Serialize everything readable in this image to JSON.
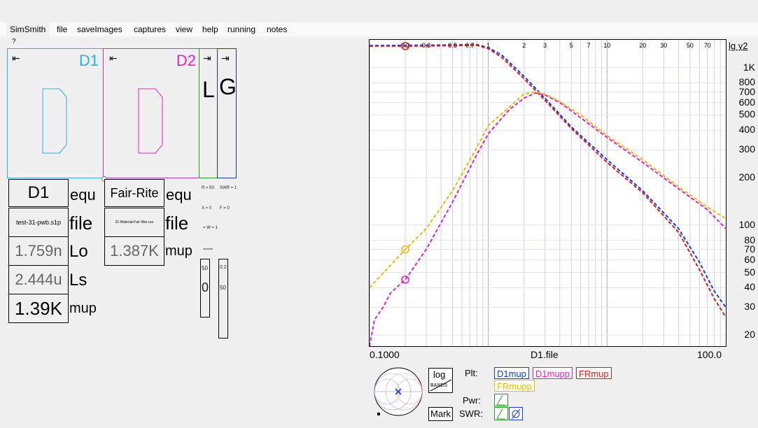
{
  "menu": [
    "SimSmith",
    "file",
    "saveImages",
    "captures",
    "view",
    "help",
    "running",
    "notes"
  ],
  "help_mark": "?",
  "components": {
    "d1": {
      "name": "D1",
      "color": "#2ab0e8"
    },
    "d2": {
      "name": "D2",
      "color": "#e020d0"
    },
    "l": {
      "name": "L",
      "color": "#2a9a2a"
    },
    "g": {
      "name": "G",
      "color": "#203a9a"
    }
  },
  "d1_params": {
    "title": "D1",
    "title_suffix": "equ",
    "file": "test-31-pwb.s1p",
    "file_suffix": "file",
    "lo": "1.759n",
    "lo_suffix": "Lo",
    "ls": "2.444u",
    "ls_suffix": "Ls",
    "mup": "1.39K",
    "mup_suffix": "mup"
  },
  "d2_params": {
    "title": "Fair-Rite",
    "title_suffix": "equ",
    "file": "31-Material-Fair-Rite.csv",
    "file_suffix": "file",
    "mup": "1.387K",
    "mup_suffix": "mup"
  },
  "tiny_labels": {
    "r": "R = 50",
    "swr": "SWR = 1",
    "x": "X = 0",
    "f": "F = 0",
    "w": "= W = 1",
    "v1": "50",
    "v2": "0",
    "v3": "0.2",
    "v4": "50"
  },
  "chart_data": {
    "type": "line",
    "xlabel": "D1.file",
    "ylabel": "lg y2",
    "x_scale": "log",
    "y_scale": "log",
    "xlim": [
      0.1,
      100
    ],
    "ylim": [
      17,
      1500
    ],
    "x_end_labels": [
      "0.1000",
      "100.0"
    ],
    "x_top_ticks": [
      "0.2",
      "0.3",
      "0.5",
      "0.7",
      "1",
      "2",
      "3",
      "5",
      "7",
      "10",
      "20",
      "30",
      "50",
      "70"
    ],
    "y_ticks": [
      "1K",
      "800",
      "700",
      "600",
      "500",
      "400",
      "300",
      "200",
      "100",
      "80",
      "70",
      "60",
      "50",
      "40",
      "30",
      "20"
    ],
    "series": [
      {
        "name": "D1mup",
        "color": "#1a3adc",
        "dash": "5,3",
        "x": [
          0.1,
          0.2,
          0.4,
          0.8,
          1.0,
          1.3,
          2.0,
          3.0,
          5.0,
          10,
          20,
          40,
          60,
          80,
          100
        ],
        "y": [
          1380,
          1385,
          1390,
          1400,
          1340,
          1200,
          880,
          640,
          420,
          260,
          165,
          95,
          58,
          38,
          30
        ]
      },
      {
        "name": "D1mupp",
        "color": "#e020d0",
        "dash": "5,3",
        "x": [
          0.1,
          0.11,
          0.13,
          0.15,
          0.2,
          0.3,
          0.5,
          0.8,
          1.0,
          1.5,
          2.0,
          2.5,
          3.0,
          4.0,
          6.0,
          10,
          20,
          40,
          70,
          100
        ],
        "y": [
          17,
          25,
          30,
          37,
          45,
          70,
          140,
          280,
          380,
          540,
          640,
          690,
          670,
          600,
          480,
          360,
          250,
          170,
          125,
          95
        ]
      },
      {
        "name": "FRmup",
        "color": "#dc1a1a",
        "dash": "5,3",
        "x": [
          0.1,
          0.2,
          0.4,
          0.8,
          1.0,
          1.3,
          2.0,
          3.0,
          5.0,
          10,
          20,
          40,
          60,
          80,
          100
        ],
        "y": [
          1370,
          1370,
          1375,
          1385,
          1320,
          1160,
          850,
          620,
          410,
          250,
          160,
          90,
          52,
          34,
          26
        ]
      },
      {
        "name": "FRmupp",
        "color": "#f0b800",
        "dash": "5,3",
        "x": [
          0.1,
          0.2,
          0.3,
          0.5,
          0.8,
          1.0,
          1.5,
          2.0,
          2.5,
          3.0,
          4.0,
          6.0,
          10,
          20,
          40,
          70,
          100
        ],
        "y": [
          40,
          70,
          95,
          165,
          310,
          430,
          560,
          680,
          700,
          680,
          610,
          500,
          370,
          260,
          175,
          130,
          110
        ]
      }
    ],
    "markers": [
      {
        "series": "FRmup",
        "x": 0.2,
        "y": 1370
      },
      {
        "series": "FRmupp",
        "x": 0.2,
        "y": 70
      },
      {
        "series": "D1mupp",
        "x": 0.2,
        "y": 45
      }
    ]
  },
  "bottom": {
    "log_label": "log",
    "bands_label": "BANDS",
    "mark_label": "Mark",
    "plt_label": "Plt:",
    "pwr_label": "Pwr:",
    "swr_label": "SWR:",
    "legend": [
      {
        "label": "D1mup",
        "color": "#1a3adc"
      },
      {
        "label": "D1mupp",
        "color": "#e020d0"
      },
      {
        "label": "FRmup",
        "color": "#dc1a1a"
      },
      {
        "label": "FRmupp",
        "color": "#f0b800"
      }
    ]
  }
}
